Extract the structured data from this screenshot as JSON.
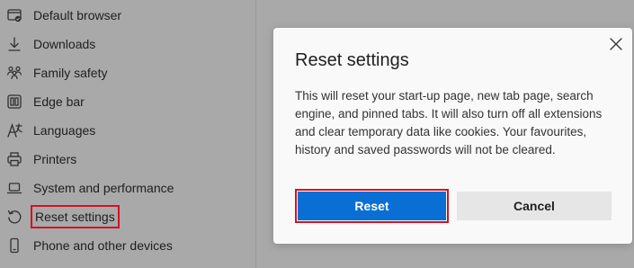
{
  "sidebar": {
    "items": [
      {
        "label": "Default browser",
        "icon": "default-browser-icon"
      },
      {
        "label": "Downloads",
        "icon": "download-icon"
      },
      {
        "label": "Family safety",
        "icon": "family-icon"
      },
      {
        "label": "Edge bar",
        "icon": "edge-bar-icon"
      },
      {
        "label": "Languages",
        "icon": "languages-icon"
      },
      {
        "label": "Printers",
        "icon": "printer-icon"
      },
      {
        "label": "System and performance",
        "icon": "laptop-icon"
      },
      {
        "label": "Reset settings",
        "icon": "reset-icon",
        "highlighted": true
      },
      {
        "label": "Phone and other devices",
        "icon": "phone-icon"
      }
    ]
  },
  "dialog": {
    "title": "Reset settings",
    "body": "This will reset your start-up page, new tab page, search engine, and pinned tabs. It will also turn off all extensions and clear temporary data like cookies. Your favourites, history and saved passwords will not be cleared.",
    "reset_label": "Reset",
    "cancel_label": "Cancel"
  },
  "colors": {
    "overlay": "#a9a9a9",
    "primary": "#0a6fd4",
    "highlight": "#d01426",
    "secondary_button": "#e6e6e6"
  }
}
